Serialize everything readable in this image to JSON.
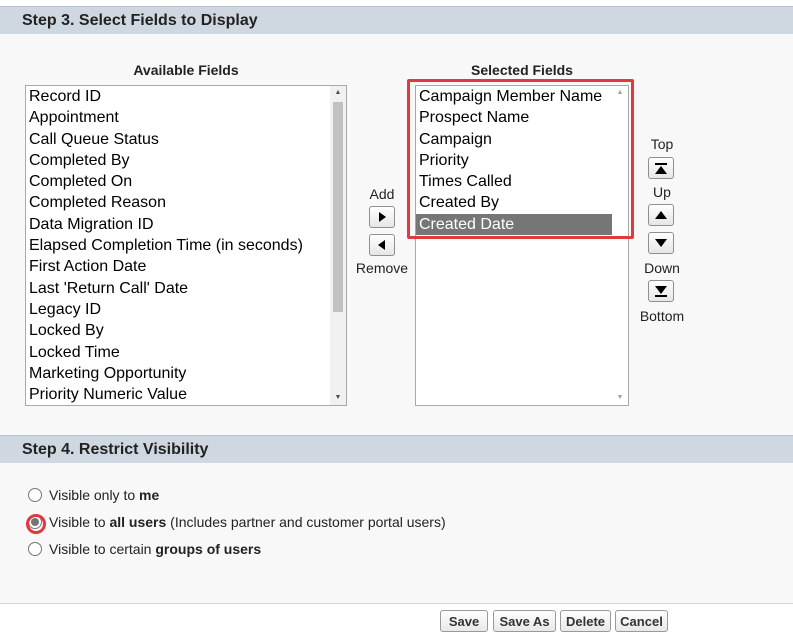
{
  "step3": {
    "title": "Step 3. Select Fields to Display",
    "available_label": "Available Fields",
    "selected_label": "Selected Fields",
    "available_fields": [
      "Record ID",
      "Appointment",
      "Call Queue Status",
      "Completed By",
      "Completed On",
      "Completed Reason",
      "Data Migration ID",
      "Elapsed Completion Time (in seconds)",
      "First Action Date",
      "Last 'Return Call' Date",
      "Legacy ID",
      "Locked By",
      "Locked Time",
      "Marketing Opportunity",
      "Priority Numeric Value"
    ],
    "selected_fields": [
      "Campaign Member Name",
      "Prospect Name",
      "Campaign",
      "Priority",
      "Times Called",
      "Created By",
      "Created Date"
    ],
    "selected_highlighted_item": "Created Date",
    "add_label": "Add",
    "remove_label": "Remove",
    "top_label": "Top",
    "up_label": "Up",
    "down_label": "Down",
    "bottom_label": "Bottom"
  },
  "step4": {
    "title": "Step 4. Restrict Visibility",
    "options": [
      {
        "prefix": "Visible only to ",
        "bold": "me",
        "suffix": "",
        "checked": false
      },
      {
        "prefix": "Visible to ",
        "bold": "all users",
        "suffix": " (Includes partner and customer portal users)",
        "checked": true
      },
      {
        "prefix": "Visible to certain ",
        "bold": "groups of users",
        "suffix": "",
        "checked": false
      }
    ]
  },
  "footer": {
    "save_label": "Save",
    "save_as_label": "Save As",
    "delete_label": "Delete",
    "cancel_label": "Cancel"
  },
  "colors": {
    "header_bg": "#cfd7e0",
    "highlight_red": "#e0393e",
    "selected_item_bg": "#767676"
  },
  "icons": {
    "add": "triangle-right-icon",
    "remove": "triangle-left-icon",
    "top": "move-top-icon",
    "up": "triangle-up-icon",
    "down": "triangle-down-icon",
    "bottom": "move-bottom-icon"
  }
}
